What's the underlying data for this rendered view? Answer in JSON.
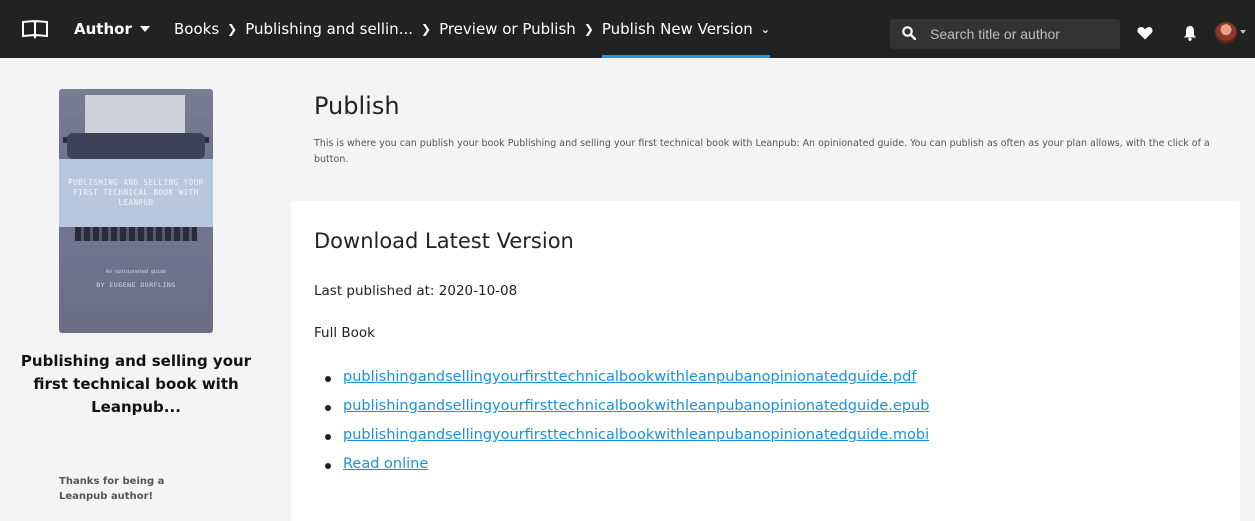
{
  "nav": {
    "author_label": "Author",
    "breadcrumbs": [
      "Books",
      "Publishing and sellin...",
      "Preview or Publish"
    ],
    "current": "Publish New Version",
    "search_placeholder": "Search title or author"
  },
  "sidebar": {
    "cover": {
      "title": "PUBLISHING AND SELLING YOUR FIRST TECHNICAL BOOK WITH LEANPUB",
      "subtitle": "An opinionated guide",
      "byline": "BY EUGENE DORFLING"
    },
    "book_title": "Publishing and selling your first technical book with Leanpub...",
    "thanks": "Thanks for being a Leanpub author!"
  },
  "main": {
    "title": "Publish",
    "description": "This is where you can publish your book Publishing and selling your first technical book with Leanpub: An opinionated guide. You can publish as often as your plan allows, with the click of a button.",
    "card": {
      "title": "Download Latest Version",
      "last_published": "Last published at: 2020-10-08",
      "full_book_label": "Full Book",
      "links": [
        "publishingandsellingyourfirsttechnicalbookwithleanpubanopinionatedguide.pdf",
        "publishingandsellingyourfirsttechnicalbookwithleanpubanopinionatedguide.epub",
        "publishingandsellingyourfirsttechnicalbookwithleanpubanopinionatedguide.mobi",
        "Read online"
      ]
    }
  },
  "colors": {
    "nav_bg": "#222222",
    "accent": "#2693e6",
    "link": "#1a90e0",
    "page_bg": "#f4f4f4"
  }
}
